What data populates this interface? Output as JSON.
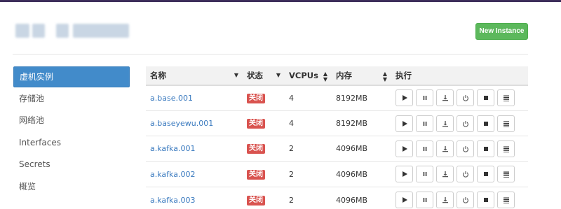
{
  "header": {
    "title_blurred": true,
    "new_button_label": "New Instance"
  },
  "sidebar": {
    "items": [
      {
        "label": "虚机实例",
        "active": true
      },
      {
        "label": "存储池",
        "active": false
      },
      {
        "label": "网络池",
        "active": false
      },
      {
        "label": "Interfaces",
        "active": false
      },
      {
        "label": "Secrets",
        "active": false
      },
      {
        "label": "概览",
        "active": false
      }
    ]
  },
  "table": {
    "columns": [
      "名称",
      "状态",
      "VCPUs",
      "内存",
      "执行"
    ],
    "rows": [
      {
        "name": "a.base.001",
        "status": "关闭",
        "vcpus": "4",
        "memory": "8192MB"
      },
      {
        "name": "a.baseyewu.001",
        "status": "关闭",
        "vcpus": "4",
        "memory": "8192MB"
      },
      {
        "name": "a.kafka.001",
        "status": "关闭",
        "vcpus": "2",
        "memory": "4096MB"
      },
      {
        "name": "a.kafka.002",
        "status": "关闭",
        "vcpus": "2",
        "memory": "4096MB"
      },
      {
        "name": "a.kafka.003",
        "status": "关闭",
        "vcpus": "2",
        "memory": "4096MB"
      }
    ],
    "actions": [
      "play-icon",
      "pause-icon",
      "download-icon",
      "power-icon",
      "stop-icon",
      "menu-icon"
    ]
  },
  "colors": {
    "accent": "#428bca",
    "success": "#5cb85c",
    "danger": "#d9534f",
    "link": "#3a7abf"
  }
}
